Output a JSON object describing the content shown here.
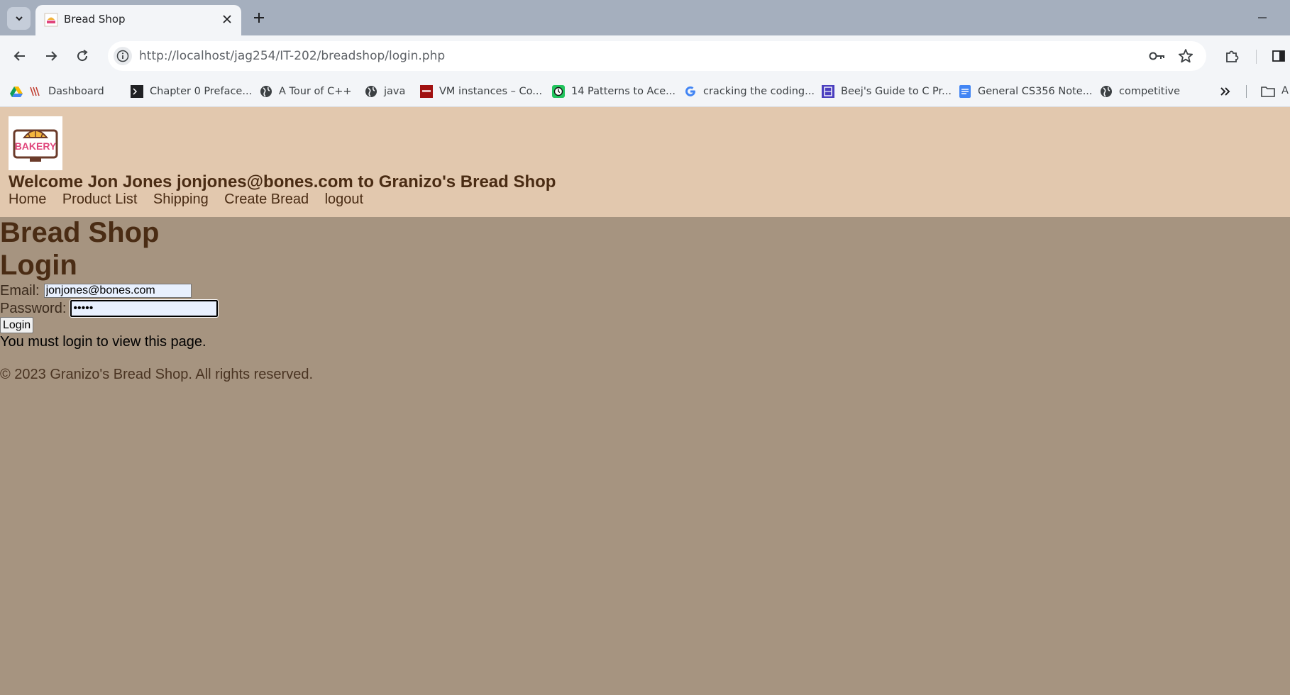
{
  "browser": {
    "tab": {
      "title": "Bread Shop"
    },
    "url": "http://localhost/jag254/IT-202/breadshop/login.php",
    "bookmarks": [
      {
        "label": "Dashboard",
        "icon": "google-drive-icon"
      },
      {
        "label": "Chapter 0 Preface...",
        "icon": "terminal-icon"
      },
      {
        "label": "A Tour of C++",
        "icon": "globe-icon"
      },
      {
        "label": "java",
        "icon": "globe-icon"
      },
      {
        "label": "VM instances – Co...",
        "icon": "njit-icon"
      },
      {
        "label": "14 Patterns to Ace...",
        "icon": "clock-icon"
      },
      {
        "label": "cracking the coding...",
        "icon": "google-icon"
      },
      {
        "label": "Beej's Guide to C Pr...",
        "icon": "book-icon"
      },
      {
        "label": "General CS356 Note...",
        "icon": "doc-icon"
      },
      {
        "label": "competitive",
        "icon": "globe-icon"
      }
    ],
    "bookmarks_folder_label": "A"
  },
  "header": {
    "logo_text": "BAKERY",
    "welcome": "Welcome Jon Jones jonjones@bones.com to Granizo's Bread Shop",
    "nav": [
      "Home",
      "Product List",
      "Shipping",
      "Create Bread",
      "logout"
    ]
  },
  "main": {
    "heading": "Bread Shop",
    "subheading": "Login",
    "email_label": "Email:",
    "email_value": "jonjones@bones.com",
    "password_label": "Password:",
    "password_value": "•••••",
    "login_button": "Login",
    "message": "You must login to view this page."
  },
  "footer": {
    "text": "© 2023 Granizo's Bread Shop. All rights reserved."
  },
  "colors": {
    "header_bg": "#e2c8ae",
    "body_bg": "#a69480",
    "heading_text": "#4a2c14"
  }
}
